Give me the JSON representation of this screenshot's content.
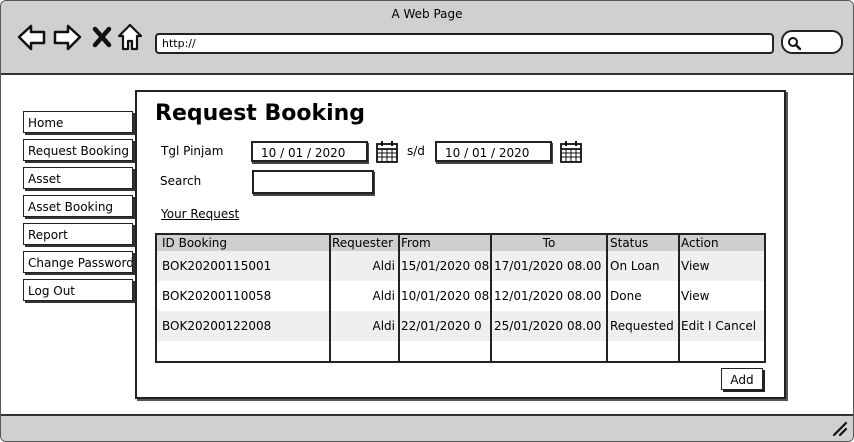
{
  "window": {
    "title": "A Web Page"
  },
  "toolbar": {
    "url": "http://"
  },
  "sidebar": {
    "items": [
      {
        "label": "Home"
      },
      {
        "label": "Request Booking"
      },
      {
        "label": "Asset"
      },
      {
        "label": "Asset Booking"
      },
      {
        "label": "Report"
      },
      {
        "label": "Change Password"
      },
      {
        "label": "Log Out"
      }
    ]
  },
  "main": {
    "title": "Request Booking",
    "filters": {
      "date_label": "Tgl Pinjam",
      "date_from": "10 / 01 / 2020",
      "range_sep": "s/d",
      "date_to": "10 / 01 / 2020",
      "search_label": "Search",
      "search_value": ""
    },
    "section_link": "Your Request",
    "table": {
      "headers": [
        "ID Booking",
        "Requester",
        "From",
        "To",
        "Status",
        "Action"
      ],
      "rows": [
        [
          "BOK20200115001",
          "Aldi",
          "15/01/2020 08",
          "17/01/2020 08.00",
          "On Loan",
          "View"
        ],
        [
          "BOK20200110058",
          "Aldi",
          "10/01/2020 08",
          "12/01/2020 08.00",
          "Done",
          "View"
        ],
        [
          "BOK20200122008",
          "Aldi",
          "22/01/2020 0",
          "25/01/2020 08.00",
          "Requested",
          "Edit I Cancel"
        ]
      ]
    },
    "add_label": "Add"
  }
}
